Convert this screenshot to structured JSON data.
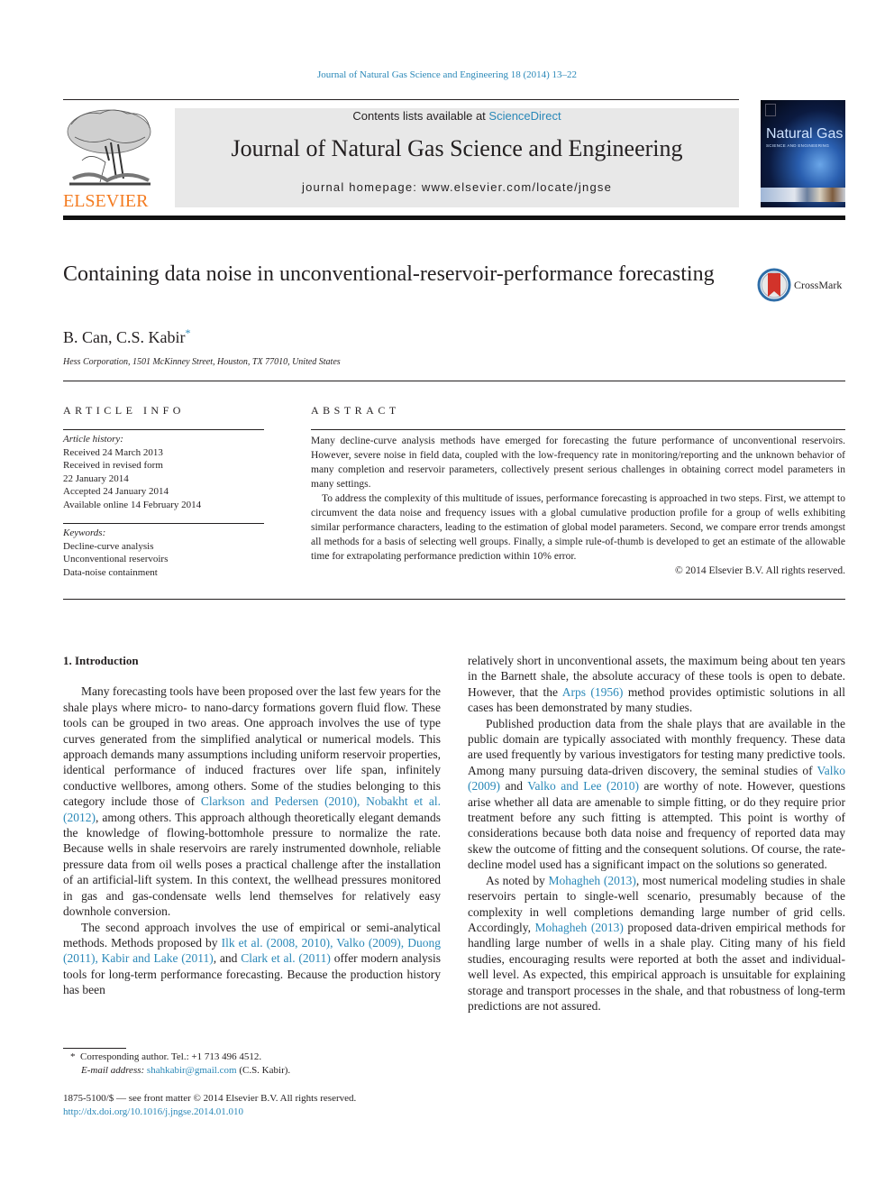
{
  "running_header": "Journal of Natural Gas Science and Engineering 18 (2014) 13–22",
  "masthead": {
    "publisher_logo_text": "ELSEVIER",
    "contents_prefix": "Contents lists available at ",
    "contents_link": "ScienceDirect",
    "journal_title": "Journal of Natural Gas Science and Engineering",
    "homepage": "journal homepage: www.elsevier.com/locate/jngse",
    "cover": {
      "title": "Natural Gas",
      "subtitle": "SCIENCE AND ENGINEERING"
    }
  },
  "article": {
    "title": "Containing data noise in unconventional-reservoir-performance forecasting",
    "crossmark_label": "CrossMark",
    "authors": "B. Can, C.S. Kabir",
    "author_marker": "*",
    "affiliation": "Hess Corporation, 1501 McKinney Street, Houston, TX 77010, United States"
  },
  "article_info": {
    "heading": "ARTICLE INFO",
    "history_label": "Article history:",
    "history": [
      "Received 24 March 2013",
      "Received in revised form",
      "22 January 2014",
      "Accepted 24 January 2014",
      "Available online 14 February 2014"
    ],
    "keywords_label": "Keywords:",
    "keywords": [
      "Decline-curve analysis",
      "Unconventional reservoirs",
      "Data-noise containment"
    ]
  },
  "abstract": {
    "heading": "ABSTRACT",
    "paragraphs": [
      "Many decline-curve analysis methods have emerged for forecasting the future performance of unconventional reservoirs. However, severe noise in field data, coupled with the low-frequency rate in monitoring/reporting and the unknown behavior of many completion and reservoir parameters, collectively present serious challenges in obtaining correct model parameters in many settings.",
      "To address the complexity of this multitude of issues, performance forecasting is approached in two steps. First, we attempt to circumvent the data noise and frequency issues with a global cumulative production profile for a group of wells exhibiting similar performance characters, leading to the estimation of global model parameters. Second, we compare error trends amongst all methods for a basis of selecting well groups. Finally, a simple rule-of-thumb is developed to get an estimate of the allowable time for extrapolating performance prediction within 10% error."
    ],
    "copyright": "© 2014 Elsevier B.V. All rights reserved."
  },
  "body": {
    "section_heading": "1.  Introduction",
    "left": {
      "p1_a": "Many forecasting tools have been proposed over the last few years for the shale plays where micro- to nano-darcy formations govern fluid flow. These tools can be grouped in two areas. One approach involves the use of type curves generated from the simplified analytical or numerical models. This approach demands many assumptions including uniform reservoir properties, identical performance of induced fractures over life span, infinitely conductive wellbores, among others. Some of the studies belonging to this category include those of ",
      "p1_ref1": "Clarkson and Pedersen (2010), Nobakht et al. (2012)",
      "p1_b": ", among others. This approach although theoretically elegant demands the knowledge of flowing-bottomhole pressure to normalize the rate. Because wells in shale reservoirs are rarely instrumented downhole, reliable pressure data from oil wells poses a practical challenge after the installation of an artificial-lift system. In this context, the wellhead pressures monitored in gas and gas-condensate wells lend themselves for relatively easy downhole conversion.",
      "p2_a": "The second approach involves the use of empirical or semi-analytical methods. Methods proposed by ",
      "p2_ref1": "Ilk et al. (2008, 2010), Valko (2009), Duong (2011), Kabir and Lake (2011)",
      "p2_b": ", and ",
      "p2_ref2": "Clark et al. (2011)",
      "p2_c": " offer modern analysis tools for long-term performance forecasting. Because the production history has been"
    },
    "right": {
      "p1_a": "relatively short in unconventional assets, the maximum being about ten years in the Barnett shale, the absolute accuracy of these tools is open to debate. However, that the ",
      "p1_ref1": "Arps (1956)",
      "p1_b": " method provides optimistic solutions in all cases has been demonstrated by many studies.",
      "p2_a": "Published production data from the shale plays that are available in the public domain are typically associated with monthly frequency. These data are used frequently by various investigators for testing many predictive tools. Among many pursuing data-driven discovery, the seminal studies of ",
      "p2_ref1": "Valko (2009)",
      "p2_b": " and ",
      "p2_ref2": "Valko and Lee (2010)",
      "p2_c": " are worthy of note. However, questions arise whether all data are amenable to simple fitting, or do they require prior treatment before any such fitting is attempted. This point is worthy of considerations because both data noise and frequency of reported data may skew the outcome of fitting and the consequent solutions. Of course, the rate-decline model used has a significant impact on the solutions so generated.",
      "p3_a": "As noted by ",
      "p3_ref1": "Mohagheh (2013)",
      "p3_b": ", most numerical modeling studies in shale reservoirs pertain to single-well scenario, presumably because of the complexity in well completions demanding large number of grid cells. Accordingly, ",
      "p3_ref2": "Mohagheh (2013)",
      "p3_c": " proposed data-driven empirical methods for handling large number of wells in a shale play. Citing many of his field studies, encouraging results were reported at both the asset and individual-well level. As expected, this empirical approach is unsuitable for explaining storage and transport processes in the shale, and that robustness of long-term predictions are not assured."
    }
  },
  "footnote": {
    "marker": "*",
    "corresponding": "Corresponding author. Tel.: +1 713 496 4512.",
    "email_label": "E-mail address:",
    "email": "shahkabir@gmail.com",
    "email_suffix": " (C.S. Kabir)."
  },
  "front_matter": {
    "issn_line": "1875-5100/$ — see front matter © 2014 Elsevier B.V. All rights reserved.",
    "doi": "http://dx.doi.org/10.1016/j.jngse.2014.01.010"
  },
  "colors": {
    "link": "#2a88b8",
    "elsevier_orange": "#f47b20",
    "masthead_band": "#e8e8e8",
    "text": "#231f20"
  }
}
